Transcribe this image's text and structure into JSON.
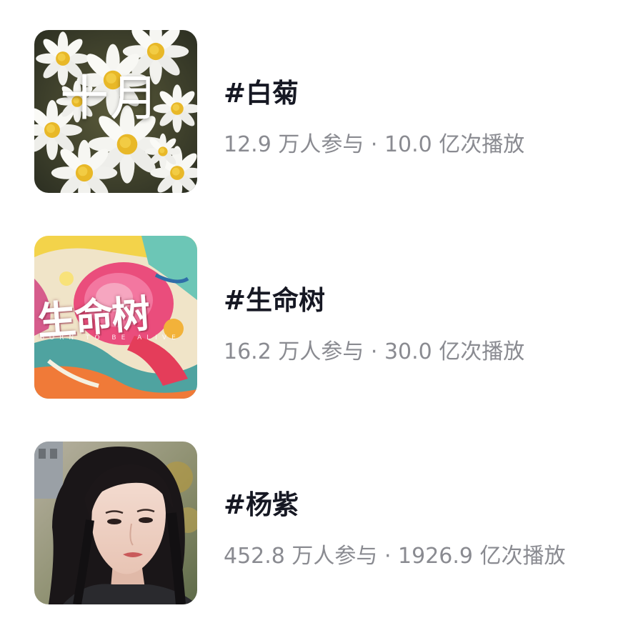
{
  "topics": [
    {
      "thumbnail_icon": "white-daisies-photo",
      "thumbnail_text": "十月",
      "title": "#白菊",
      "meta": "12.9 万人参与 · 10.0 亿次播放"
    },
    {
      "thumbnail_icon": "colorful-flower-painting",
      "thumbnail_text": "生命树",
      "thumbnail_subtext": "BORN TO BE ALIVE",
      "title": "#生命树",
      "meta": "16.2 万人参与 · 30.0 亿次播放"
    },
    {
      "thumbnail_icon": "woman-portrait-photo",
      "title": "#杨紫",
      "meta": "452.8 万人参与 · 1926.9 亿次播放"
    }
  ],
  "colors": {
    "title": "#161823",
    "meta": "#8a8b91",
    "background": "#ffffff"
  }
}
